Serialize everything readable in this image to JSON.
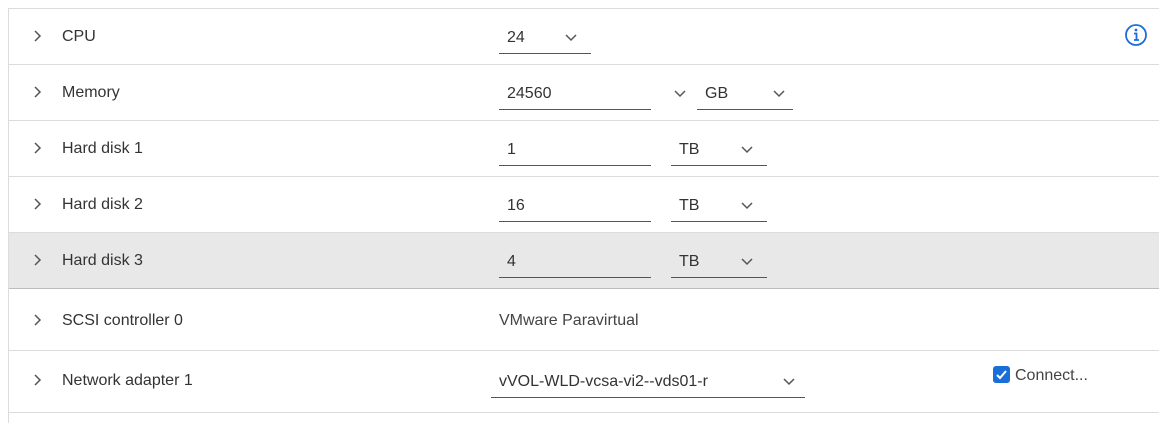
{
  "rows": [
    {
      "label": "CPU",
      "value": "24"
    },
    {
      "label": "Memory",
      "value": "24560",
      "unit": "GB"
    },
    {
      "label": "Hard disk 1",
      "value": "1",
      "unit": "TB"
    },
    {
      "label": "Hard disk 2",
      "value": "16",
      "unit": "TB"
    },
    {
      "label": "Hard disk 3",
      "value": "4",
      "unit": "TB"
    },
    {
      "label": "SCSI controller 0",
      "value": "VMware Paravirtual"
    },
    {
      "label": "Network adapter 1",
      "value": "vVOL-WLD-vcsa-vi2--vds01-r",
      "connect_label": "Connect..."
    }
  ],
  "colors": {
    "accent": "#1a6ed8",
    "row_selected": "#e8e8e8"
  }
}
